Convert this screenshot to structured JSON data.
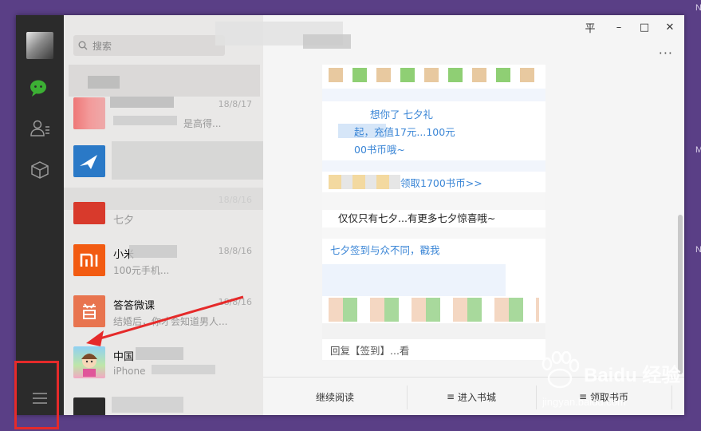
{
  "background": {
    "right_letters": [
      "N",
      "M",
      "N"
    ]
  },
  "sidebar": {
    "icons": [
      "chat-icon",
      "contacts-icon",
      "favorites-icon"
    ],
    "menu_icon": "hamburger-icon"
  },
  "search": {
    "placeholder": "搜索",
    "icon": "search-icon"
  },
  "chats": [
    {
      "name": "",
      "preview": "",
      "date": ""
    },
    {
      "name": "",
      "preview": "是高得...",
      "date": "18/8/17"
    },
    {
      "name": "",
      "preview": "",
      "date": ""
    },
    {
      "name": "七夕",
      "preview": "",
      "date": "18/8/16"
    },
    {
      "name": "小米",
      "preview": "100元手机...",
      "date": "18/8/16"
    },
    {
      "name": "答答微课",
      "preview": "结婚后，你才会知道男人...",
      "date": "18/8/16"
    },
    {
      "name": "中国",
      "preview": "iPhone",
      "date": ""
    },
    {
      "name": "",
      "preview": "",
      "date": ""
    }
  ],
  "window_controls": {
    "pin": "平",
    "minimize": "–",
    "maximize": "□",
    "close": "✕",
    "more": "···"
  },
  "article": {
    "lines": [
      "想你了   七夕礼",
      "起，充值17元...100元",
      "00书币哦~",
      "领取1700书币>>",
      "仅仅只有七夕...有更多七夕惊喜哦~",
      "七夕签到与众不同，戳我",
      "回复【签到】...看"
    ]
  },
  "bottom_menu": {
    "items": [
      "继续阅读",
      "进入书城",
      "领取书币"
    ]
  },
  "watermark": {
    "brand": "Baidu 经验",
    "url": "jingyan.baidu.com"
  },
  "colors": {
    "accent_green": "#3cb034",
    "highlight_red": "#e52a2a",
    "link_blue": "#3b86d6",
    "sidebar": "#2b2b2b"
  }
}
